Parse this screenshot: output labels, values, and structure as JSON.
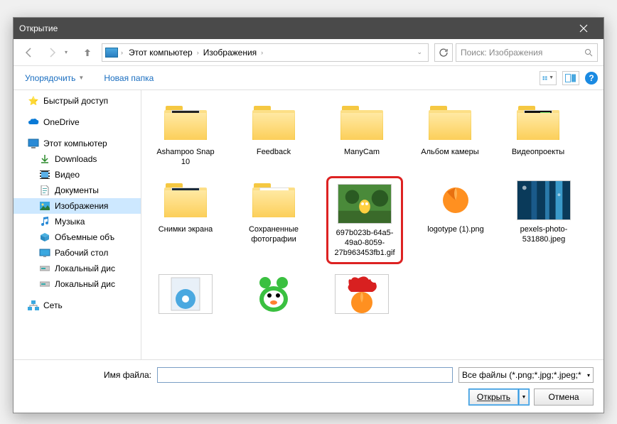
{
  "title": "Открытие",
  "breadcrumb": {
    "root": "Этот компьютер",
    "folder": "Изображения"
  },
  "search_placeholder": "Поиск: Изображения",
  "toolbar": {
    "organize": "Упорядочить",
    "new_folder": "Новая папка"
  },
  "sidebar": {
    "quick_access": "Быстрый доступ",
    "onedrive": "OneDrive",
    "this_pc": "Этот компьютер",
    "downloads": "Downloads",
    "videos": "Видео",
    "documents": "Документы",
    "pictures": "Изображения",
    "music": "Музыка",
    "objects3d": "Объемные объ",
    "desktop": "Рабочий стол",
    "local_disk1": "Локальный дис",
    "local_disk2": "Локальный дис",
    "network": "Сеть"
  },
  "files": {
    "f1": "Ashampoo Snap 10",
    "f2": "Feedback",
    "f3": "ManyCam",
    "f4": "Альбом камеры",
    "f5": "Видеопроекты",
    "f6": "Снимки экрана",
    "f7": "Сохраненные фотографии",
    "f8": "697b023b-64a5-49a0-8059-27b963453fb1.gif",
    "f9": "logotype (1).png",
    "f10": "pexels-photo-531880.jpeg"
  },
  "footer": {
    "filename_label": "Имя файла:",
    "filter": "Все файлы (*.png;*.jpg;*.jpeg;*",
    "open": "Открыть",
    "cancel": "Отмена"
  }
}
